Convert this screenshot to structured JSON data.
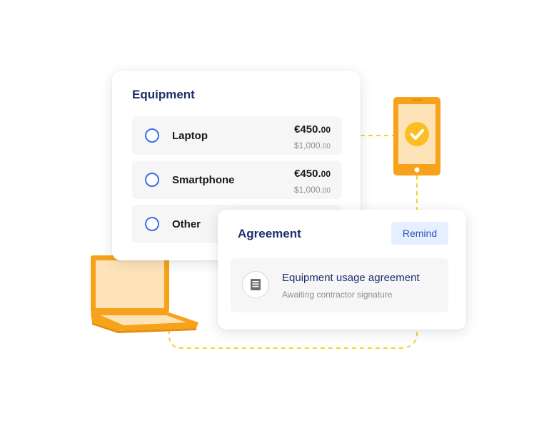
{
  "equipment": {
    "title": "Equipment",
    "items": [
      {
        "label": "Laptop",
        "price_main": "€450.",
        "price_cents": "00",
        "sub_main": "$1,000.",
        "sub_cents": "00"
      },
      {
        "label": "Smartphone",
        "price_main": "€450.",
        "price_cents": "00",
        "sub_main": "$1,000.",
        "sub_cents": "00"
      },
      {
        "label": "Other"
      }
    ]
  },
  "agreement": {
    "title": "Agreement",
    "remind_label": "Remind",
    "document": {
      "title": "Equipment usage agreement",
      "status": "Awaiting contractor signature",
      "icon": "document-icon"
    }
  },
  "illustrations": {
    "phone_icon": "smartphone-icon",
    "check_icon": "check-icon",
    "laptop_icon": "laptop-icon"
  },
  "colors": {
    "accent_orange": "#f7a21b",
    "light_orange": "#ffe3b8",
    "check_yellow": "#fbbf24",
    "connector_yellow": "#f5d033",
    "title_navy": "#1d2f6b",
    "radio_blue": "#3b6fe0",
    "remind_bg": "#e6efff"
  }
}
